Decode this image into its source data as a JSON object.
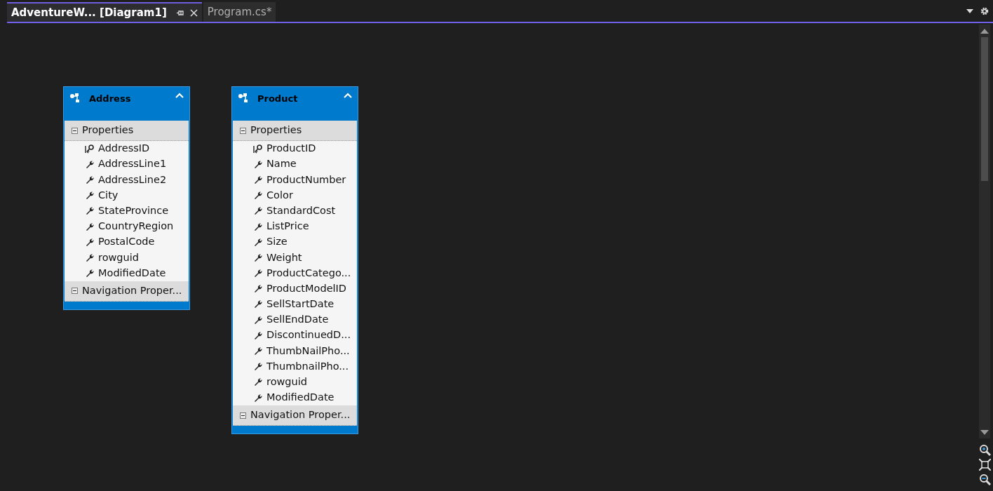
{
  "tabs": [
    {
      "label": "AdventureW... [Diagram1]",
      "selected": true
    },
    {
      "label": "Program.cs*",
      "selected": false
    }
  ],
  "entities": [
    {
      "name": "Address",
      "sections": [
        {
          "title": "Properties",
          "items": [
            {
              "name": "AddressID",
              "kind": "key"
            },
            {
              "name": "AddressLine1",
              "kind": "property"
            },
            {
              "name": "AddressLine2",
              "kind": "property"
            },
            {
              "name": "City",
              "kind": "property"
            },
            {
              "name": "StateProvince",
              "kind": "property"
            },
            {
              "name": "CountryRegion",
              "kind": "property"
            },
            {
              "name": "PostalCode",
              "kind": "property"
            },
            {
              "name": "rowguid",
              "kind": "property"
            },
            {
              "name": "ModifiedDate",
              "kind": "property"
            }
          ]
        },
        {
          "title": "Navigation Proper..."
        }
      ]
    },
    {
      "name": "Product",
      "sections": [
        {
          "title": "Properties",
          "items": [
            {
              "name": "ProductID",
              "kind": "key"
            },
            {
              "name": "Name",
              "kind": "property"
            },
            {
              "name": "ProductNumber",
              "kind": "property"
            },
            {
              "name": "Color",
              "kind": "property"
            },
            {
              "name": "StandardCost",
              "kind": "property"
            },
            {
              "name": "ListPrice",
              "kind": "property"
            },
            {
              "name": "Size",
              "kind": "property"
            },
            {
              "name": "Weight",
              "kind": "property"
            },
            {
              "name": "ProductCatego...",
              "kind": "property"
            },
            {
              "name": "ProductModelID",
              "kind": "property"
            },
            {
              "name": "SellStartDate",
              "kind": "property"
            },
            {
              "name": "SellEndDate",
              "kind": "property"
            },
            {
              "name": "DiscontinuedD...",
              "kind": "property"
            },
            {
              "name": "ThumbNailPho...",
              "kind": "property"
            },
            {
              "name": "ThumbnailPho...",
              "kind": "property"
            },
            {
              "name": "rowguid",
              "kind": "property"
            },
            {
              "name": "ModifiedDate",
              "kind": "property"
            }
          ]
        },
        {
          "title": "Navigation Proper..."
        }
      ]
    }
  ]
}
